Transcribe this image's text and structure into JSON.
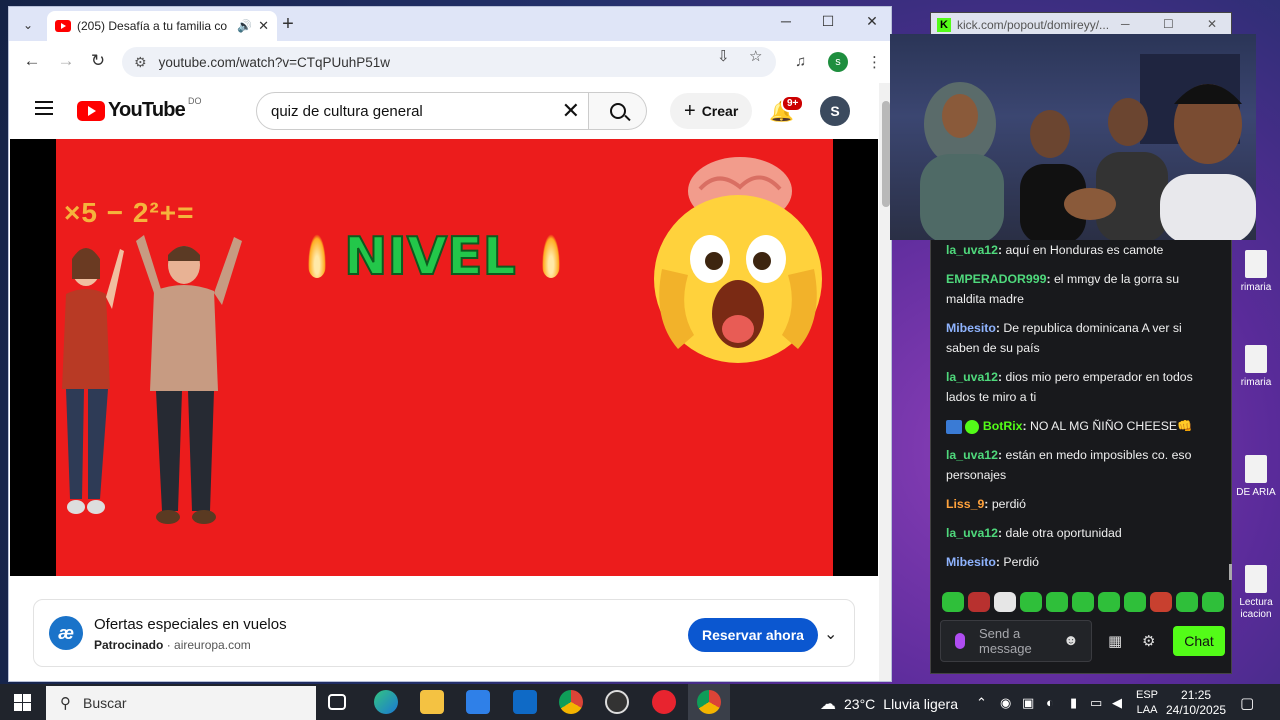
{
  "browser": {
    "tab_title": "(205) Desafía a tu familia co",
    "url": "youtube.com/watch?v=CTqPUuhP51w",
    "profile_initial": "s"
  },
  "youtube": {
    "logo_text": "YouTube",
    "country_code": "DO",
    "search_value": "quiz de cultura general",
    "create_label": "Crear",
    "notif_count": "9+",
    "avatar_initial": "S"
  },
  "video": {
    "math_text": "×5 − 2²+=",
    "title_text": "NIVEL"
  },
  "ad": {
    "logo_letter": "æ",
    "title": "Ofertas especiales en vuelos",
    "sponsored": "Patrocinado",
    "domain": "aireuropa.com",
    "cta": "Reservar ahora"
  },
  "kick": {
    "popout_url": "kick.com/popout/domireyy/...",
    "chat": [
      {
        "user": "la_uva12",
        "color": "#4fd97c",
        "text": "aquí en Honduras es camote"
      },
      {
        "user": "EMPERADOR999",
        "color": "#4fd97c",
        "text": "el mmgv de la gorra su maldita madre"
      },
      {
        "user": "Mibesito",
        "color": "#8fb4ff",
        "text": "De republica dominicana A ver si saben de su país"
      },
      {
        "user": "la_uva12",
        "color": "#4fd97c",
        "text": "dios mio pero emperador en todos lados te miro a ti"
      },
      {
        "user": "BotRix",
        "color": "#53fc18",
        "text": "NO AL MG ÑIÑO CHEESE👊"
      },
      {
        "user": "la_uva12",
        "color": "#4fd97c",
        "text": "están en medo imposibles co. eso personajes"
      },
      {
        "user": "Liss_9",
        "color": "#ffa23c",
        "text": "perdió"
      },
      {
        "user": "la_uva12",
        "color": "#4fd97c",
        "text": "dale otra oportunidad"
      },
      {
        "user": "Mibesito",
        "color": "#8fb4ff",
        "text": "Perdió"
      }
    ],
    "input_placeholder": "Send a message",
    "chat_button": "Chat"
  },
  "desktop_icons": [
    "rimaria",
    "rimaria",
    "DE ARIA",
    "Lectura icacion"
  ],
  "taskbar": {
    "search_placeholder": "Buscar",
    "temperature": "23°C",
    "weather": "Lluvia ligera",
    "lang_top": "ESP",
    "lang_bottom": "LAA",
    "time": "21:25",
    "date": "24/10/2025"
  }
}
